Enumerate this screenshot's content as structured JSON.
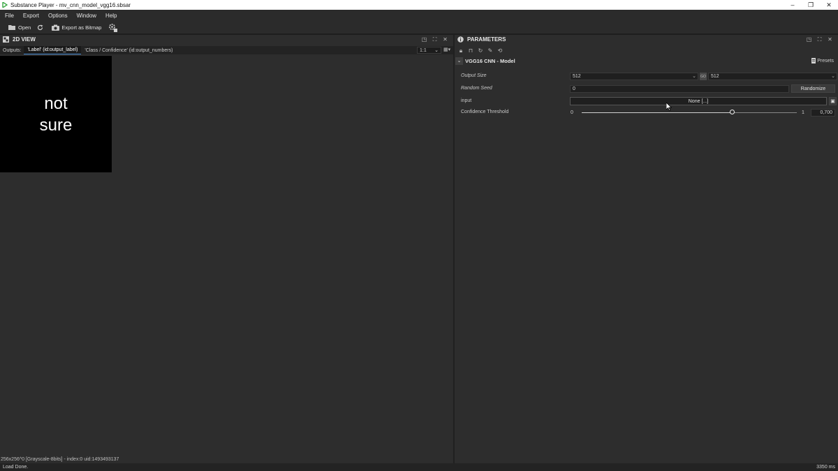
{
  "window": {
    "title": "Substance Player - mv_cnn_model_vgg16.sbsar",
    "minimize": "–",
    "restore": "❐",
    "close": "✕"
  },
  "menu": [
    "File",
    "Export",
    "Options",
    "Window",
    "Help"
  ],
  "toolbar": {
    "open_label": "Open",
    "export_label": "Export as Bitmap"
  },
  "view_panel": {
    "title": "2D VIEW",
    "outputs_label": "Outputs:",
    "tabs": [
      "'Label' (id:output_label)",
      "'Class / Confidence' (id:output_numbers)"
    ],
    "zoom": "1:1",
    "image_text_line1": "not",
    "image_text_line2": "sure",
    "footer_info": "256x256^0 [Grayscale-8bits] - index:0 uid:1493493137"
  },
  "param_panel": {
    "title": "PARAMETERS",
    "section_title": "VGG16 CNN - Model",
    "presets_label": "Presets",
    "output_size_label": "Output Size",
    "output_size_w": "512",
    "output_size_h": "512",
    "random_seed_label": "Random Seed",
    "random_seed_value": "0",
    "randomize_label": "Randomize",
    "input_label": "input",
    "input_value": "None [...]",
    "confidence_label": "Confidence Threshold",
    "confidence_min": "0",
    "confidence_max": "1",
    "confidence_value": "0,700",
    "confidence_fraction": 0.7
  },
  "status": {
    "left": "Load Done.",
    "right": "3350 ms"
  }
}
